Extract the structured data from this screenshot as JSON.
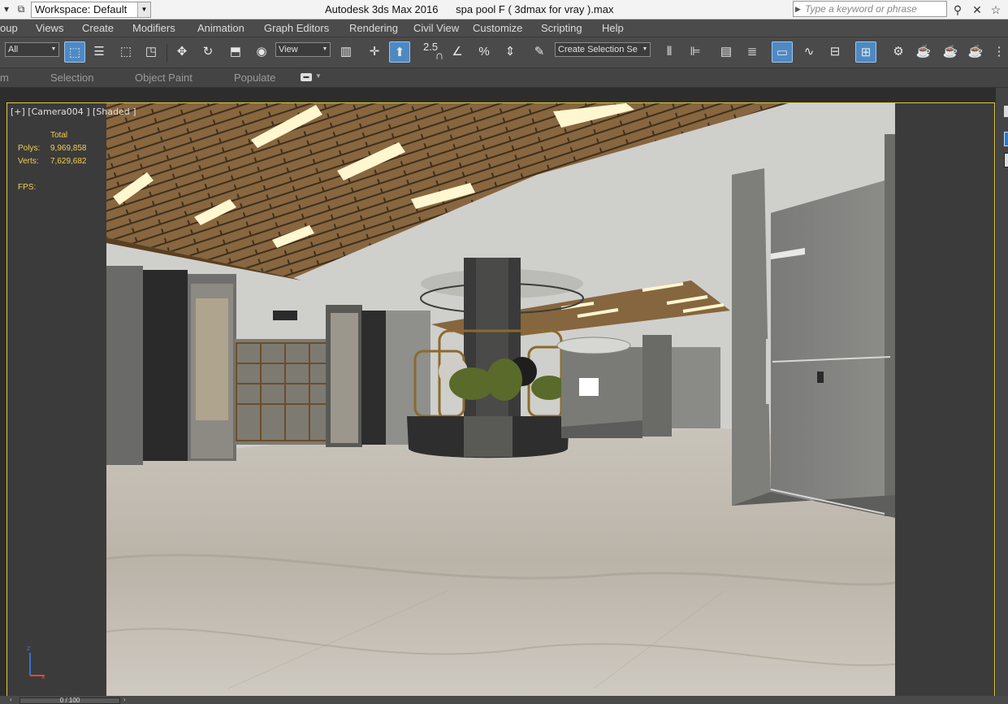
{
  "titlebar": {
    "workspace_label": "Workspace: Default",
    "app_title": "Autodesk 3ds Max 2016",
    "file_title": "spa pool F ( 3dmax for vray ).max",
    "search_placeholder": "Type a keyword or phrase"
  },
  "menu": {
    "items": [
      "oup",
      "Views",
      "Create",
      "Modifiers",
      "Animation",
      "Graph Editors",
      "Rendering",
      "Civil View",
      "Customize",
      "Scripting",
      "Help"
    ]
  },
  "toolbar": {
    "selection_filter": "All",
    "reference_coord": "View",
    "angle_snap": "2.5",
    "named_selection_placeholder": "Create Selection Se"
  },
  "ribbon": {
    "items": [
      "m",
      "Selection",
      "Object Paint",
      "Populate"
    ]
  },
  "viewport": {
    "label": "[+] [Camera004 ] [Shaded ]",
    "stats_header": "Total",
    "polys_label": "Polys:",
    "polys_value": "9,969,858",
    "verts_label": "Verts:",
    "verts_value": "7,629,682",
    "fps_label": "FPS:",
    "border_color": "#e0c84a"
  },
  "axis": {
    "z": "z",
    "x": "x"
  },
  "timeline": {
    "frame": "0 / 100"
  }
}
